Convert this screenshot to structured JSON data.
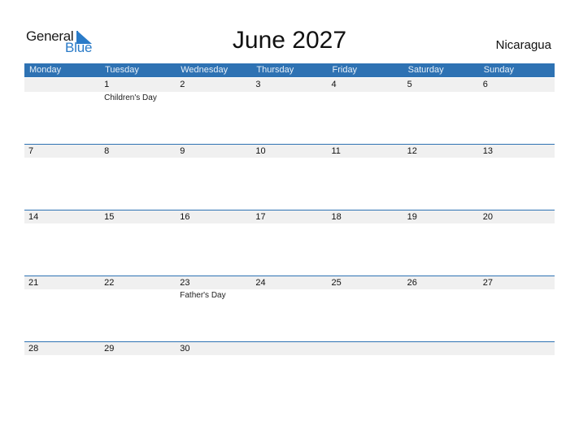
{
  "logo": {
    "word1": "General",
    "word2": "Blue"
  },
  "title": "June 2027",
  "country": "Nicaragua",
  "colors": {
    "header_bg": "#2e72b3",
    "band_bg": "#f0f0f0",
    "brand_blue": "#2a7bc8"
  },
  "weekdays": [
    "Monday",
    "Tuesday",
    "Wednesday",
    "Thursday",
    "Friday",
    "Saturday",
    "Sunday"
  ],
  "weeks": [
    {
      "days": [
        "",
        "1",
        "2",
        "3",
        "4",
        "5",
        "6"
      ],
      "events": [
        "",
        "Children's Day",
        "",
        "",
        "",
        "",
        ""
      ]
    },
    {
      "days": [
        "7",
        "8",
        "9",
        "10",
        "11",
        "12",
        "13"
      ],
      "events": [
        "",
        "",
        "",
        "",
        "",
        "",
        ""
      ]
    },
    {
      "days": [
        "14",
        "15",
        "16",
        "17",
        "18",
        "19",
        "20"
      ],
      "events": [
        "",
        "",
        "",
        "",
        "",
        "",
        ""
      ]
    },
    {
      "days": [
        "21",
        "22",
        "23",
        "24",
        "25",
        "26",
        "27"
      ],
      "events": [
        "",
        "",
        "Father's Day",
        "",
        "",
        "",
        ""
      ]
    },
    {
      "days": [
        "28",
        "29",
        "30",
        "",
        "",
        "",
        ""
      ],
      "events": [
        "",
        "",
        "",
        "",
        "",
        "",
        ""
      ]
    }
  ]
}
